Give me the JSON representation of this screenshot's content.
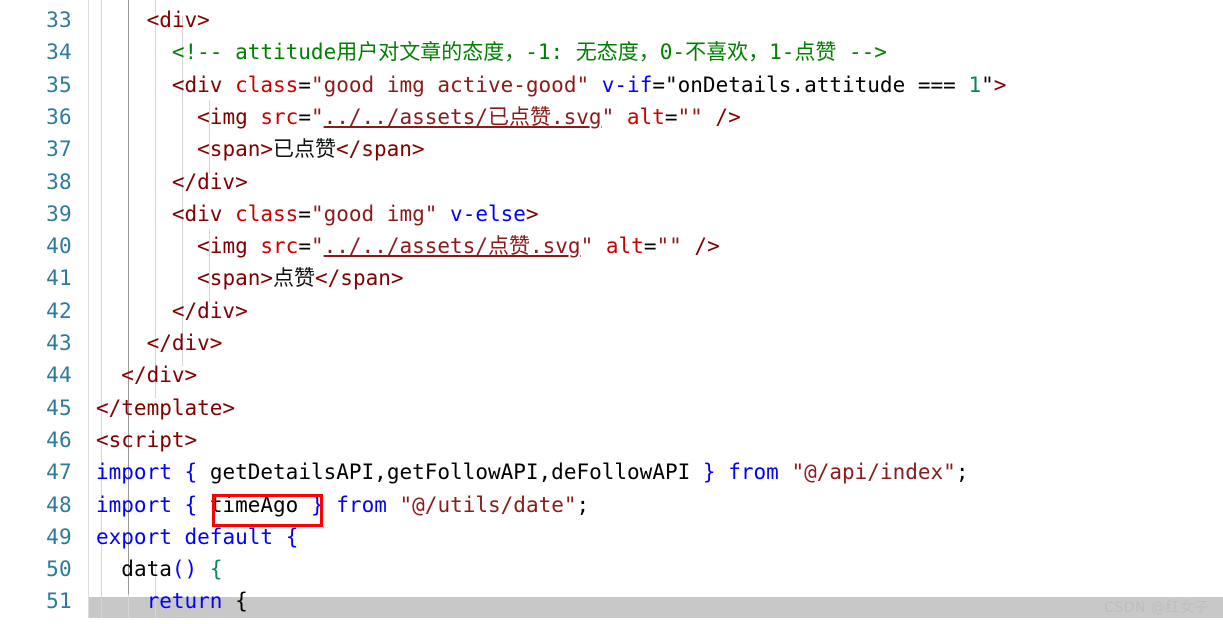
{
  "editor": {
    "language": "vue",
    "first_visible_line": 33,
    "last_visible_line": 51,
    "line_height_px": 32.3,
    "colors": {
      "background": "#ffffff",
      "gutter_text": "#2b7a9e",
      "tag": "#800000",
      "attribute": "#cc0000",
      "directive": "#0000ff",
      "string": "#8b1a1a",
      "comment": "#008000",
      "keyword": "#0000ff",
      "number": "#098658",
      "annotation_box": "#ff0000",
      "current_line_band": "#c8c8c8",
      "indent_guide": "#d6d6d6"
    },
    "gutter_numbers": [
      "33",
      "34",
      "35",
      "36",
      "37",
      "38",
      "39",
      "40",
      "41",
      "42",
      "43",
      "44",
      "45",
      "46",
      "47",
      "48",
      "49",
      "50",
      "51"
    ],
    "lines": [
      {
        "number": "33",
        "tokens": [
          {
            "text": "    ",
            "cls": "t-plain"
          },
          {
            "text": "<div>",
            "cls": "t-tag"
          }
        ]
      },
      {
        "number": "34",
        "tokens": [
          {
            "text": "      ",
            "cls": "t-plain"
          },
          {
            "text": "<!-- attitude用户对文章的态度，-1: 无态度，0-不喜欢，1-点赞 -->",
            "cls": "t-comment"
          }
        ]
      },
      {
        "number": "35",
        "tokens": [
          {
            "text": "      ",
            "cls": "t-plain"
          },
          {
            "text": "<div ",
            "cls": "t-tag"
          },
          {
            "text": "class",
            "cls": "t-attr"
          },
          {
            "text": "=",
            "cls": "t-plain"
          },
          {
            "text": "\"good img active-good\"",
            "cls": "t-string"
          },
          {
            "text": " ",
            "cls": "t-plain"
          },
          {
            "text": "v-if",
            "cls": "t-attrdir"
          },
          {
            "text": "=",
            "cls": "t-plain"
          },
          {
            "text": "\"onDetails.attitude === ",
            "cls": "t-plain"
          },
          {
            "text": "1",
            "cls": "t-num"
          },
          {
            "text": "\"",
            "cls": "t-plain"
          },
          {
            "text": ">",
            "cls": "t-tag"
          }
        ]
      },
      {
        "number": "36",
        "tokens": [
          {
            "text": "        ",
            "cls": "t-plain"
          },
          {
            "text": "<img ",
            "cls": "t-tag"
          },
          {
            "text": "src",
            "cls": "t-attr"
          },
          {
            "text": "=",
            "cls": "t-plain"
          },
          {
            "text": "\"",
            "cls": "t-string"
          },
          {
            "text": "../../assets/已点赞.svg",
            "cls": "t-link"
          },
          {
            "text": "\"",
            "cls": "t-string"
          },
          {
            "text": " ",
            "cls": "t-plain"
          },
          {
            "text": "alt",
            "cls": "t-attr"
          },
          {
            "text": "=",
            "cls": "t-plain"
          },
          {
            "text": "\"\"",
            "cls": "t-string"
          },
          {
            "text": " ",
            "cls": "t-plain"
          },
          {
            "text": "/>",
            "cls": "t-tag"
          }
        ]
      },
      {
        "number": "37",
        "tokens": [
          {
            "text": "        ",
            "cls": "t-plain"
          },
          {
            "text": "<span>",
            "cls": "t-tag"
          },
          {
            "text": "已点赞",
            "cls": "t-text"
          },
          {
            "text": "</span>",
            "cls": "t-tag"
          }
        ]
      },
      {
        "number": "38",
        "tokens": [
          {
            "text": "      ",
            "cls": "t-plain"
          },
          {
            "text": "</div>",
            "cls": "t-tag"
          }
        ]
      },
      {
        "number": "39",
        "tokens": [
          {
            "text": "      ",
            "cls": "t-plain"
          },
          {
            "text": "<div ",
            "cls": "t-tag"
          },
          {
            "text": "class",
            "cls": "t-attr"
          },
          {
            "text": "=",
            "cls": "t-plain"
          },
          {
            "text": "\"good img\"",
            "cls": "t-string"
          },
          {
            "text": " ",
            "cls": "t-plain"
          },
          {
            "text": "v-else",
            "cls": "t-attrdir"
          },
          {
            "text": ">",
            "cls": "t-tag"
          }
        ]
      },
      {
        "number": "40",
        "tokens": [
          {
            "text": "        ",
            "cls": "t-plain"
          },
          {
            "text": "<img ",
            "cls": "t-tag"
          },
          {
            "text": "src",
            "cls": "t-attr"
          },
          {
            "text": "=",
            "cls": "t-plain"
          },
          {
            "text": "\"",
            "cls": "t-string"
          },
          {
            "text": "../../assets/点赞.svg",
            "cls": "t-link"
          },
          {
            "text": "\"",
            "cls": "t-string"
          },
          {
            "text": " ",
            "cls": "t-plain"
          },
          {
            "text": "alt",
            "cls": "t-attr"
          },
          {
            "text": "=",
            "cls": "t-plain"
          },
          {
            "text": "\"\"",
            "cls": "t-string"
          },
          {
            "text": " ",
            "cls": "t-plain"
          },
          {
            "text": "/>",
            "cls": "t-tag"
          }
        ]
      },
      {
        "number": "41",
        "tokens": [
          {
            "text": "        ",
            "cls": "t-plain"
          },
          {
            "text": "<span>",
            "cls": "t-tag"
          },
          {
            "text": "点赞",
            "cls": "t-text"
          },
          {
            "text": "</span>",
            "cls": "t-tag"
          }
        ]
      },
      {
        "number": "42",
        "tokens": [
          {
            "text": "      ",
            "cls": "t-plain"
          },
          {
            "text": "</div>",
            "cls": "t-tag"
          }
        ]
      },
      {
        "number": "43",
        "tokens": [
          {
            "text": "    ",
            "cls": "t-plain"
          },
          {
            "text": "</div>",
            "cls": "t-tag"
          }
        ]
      },
      {
        "number": "44",
        "tokens": [
          {
            "text": "  ",
            "cls": "t-plain"
          },
          {
            "text": "</div>",
            "cls": "t-tag"
          }
        ]
      },
      {
        "number": "45",
        "tokens": [
          {
            "text": "</template>",
            "cls": "t-tag"
          }
        ]
      },
      {
        "number": "46",
        "tokens": [
          {
            "text": "<script>",
            "cls": "t-tag"
          }
        ]
      },
      {
        "number": "47",
        "tokens": [
          {
            "text": "import",
            "cls": "t-kw"
          },
          {
            "text": " ",
            "cls": "t-plain"
          },
          {
            "text": "{",
            "cls": "t-punct"
          },
          {
            "text": " getDetailsAPI,getFollowAPI,deFollowAPI ",
            "cls": "t-plain"
          },
          {
            "text": "}",
            "cls": "t-punct"
          },
          {
            "text": " ",
            "cls": "t-plain"
          },
          {
            "text": "from",
            "cls": "t-kw"
          },
          {
            "text": " ",
            "cls": "t-plain"
          },
          {
            "text": "\"@/api/index\"",
            "cls": "t-string"
          },
          {
            "text": ";",
            "cls": "t-plain"
          }
        ]
      },
      {
        "number": "48",
        "tokens": [
          {
            "text": "import",
            "cls": "t-kw"
          },
          {
            "text": " ",
            "cls": "t-plain"
          },
          {
            "text": "{",
            "cls": "t-punct"
          },
          {
            "text": " timeAgo ",
            "cls": "t-plain"
          },
          {
            "text": "}",
            "cls": "t-punct"
          },
          {
            "text": " ",
            "cls": "t-plain"
          },
          {
            "text": "from",
            "cls": "t-kw"
          },
          {
            "text": " ",
            "cls": "t-plain"
          },
          {
            "text": "\"@/utils/date\"",
            "cls": "t-string"
          },
          {
            "text": ";",
            "cls": "t-plain"
          }
        ]
      },
      {
        "number": "49",
        "tokens": [
          {
            "text": "export",
            "cls": "t-kw"
          },
          {
            "text": " ",
            "cls": "t-plain"
          },
          {
            "text": "default",
            "cls": "t-kw"
          },
          {
            "text": " ",
            "cls": "t-plain"
          },
          {
            "text": "{",
            "cls": "t-punct"
          }
        ]
      },
      {
        "number": "50",
        "tokens": [
          {
            "text": "  ",
            "cls": "t-plain"
          },
          {
            "text": "data",
            "cls": "t-plain"
          },
          {
            "text": "()",
            "cls": "t-punct"
          },
          {
            "text": " ",
            "cls": "t-plain"
          },
          {
            "text": "{",
            "cls": "t-num"
          }
        ]
      },
      {
        "number": "51",
        "tokens": [
          {
            "text": "    ",
            "cls": "t-plain"
          },
          {
            "text": "return",
            "cls": "t-kw"
          },
          {
            "text": " ",
            "cls": "t-plain"
          },
          {
            "text": "{",
            "cls": "t-plain"
          }
        ]
      }
    ],
    "annotation": {
      "kind": "red-rectangle",
      "target_text": "timeAgo",
      "on_line": "48"
    }
  },
  "watermark": {
    "text": "CSDN @红女子"
  }
}
